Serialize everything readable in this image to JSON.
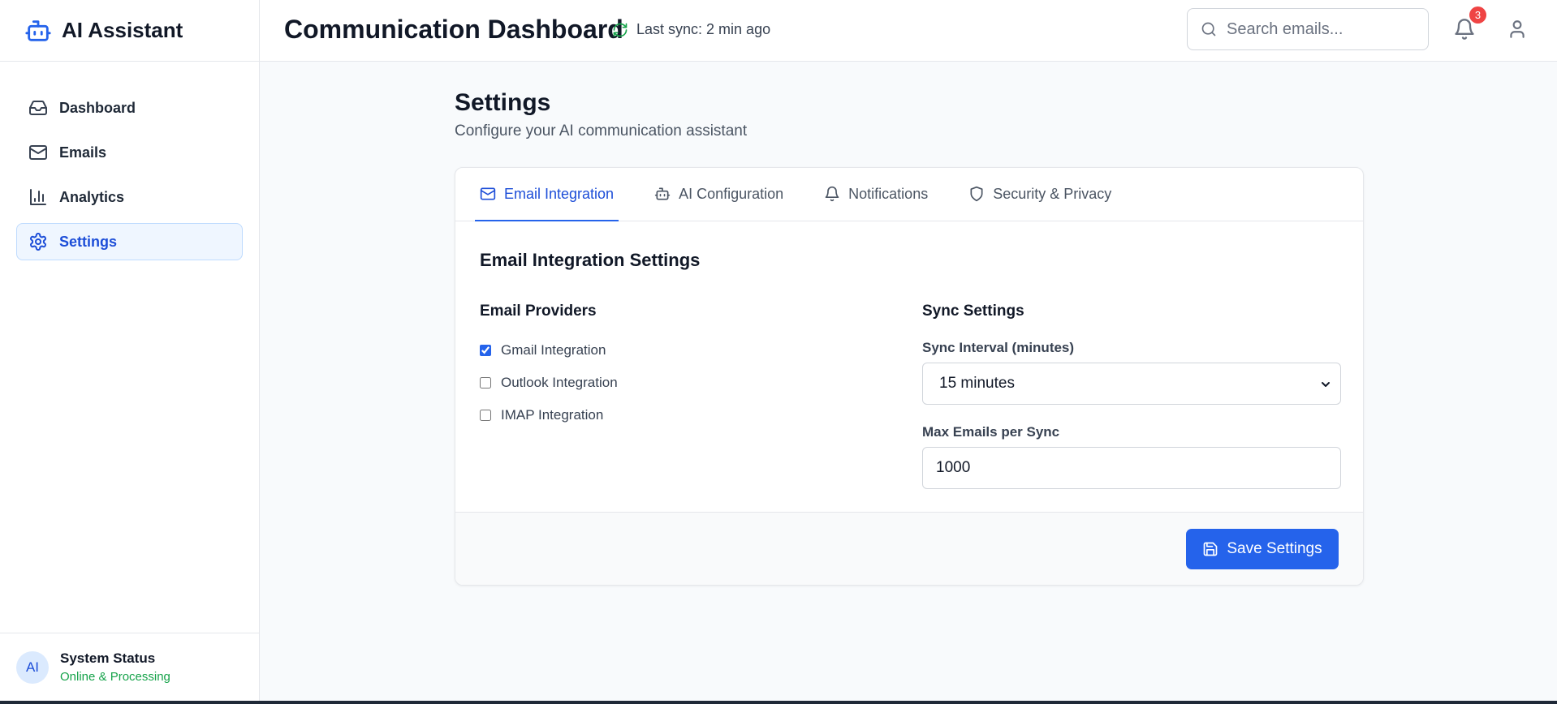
{
  "app": {
    "name": "AI Assistant"
  },
  "sidebar": {
    "items": [
      {
        "label": "Dashboard",
        "icon": "inbox-icon"
      },
      {
        "label": "Emails",
        "icon": "mail-icon"
      },
      {
        "label": "Analytics",
        "icon": "bar-chart-icon"
      },
      {
        "label": "Settings",
        "icon": "gear-icon",
        "active": true
      }
    ],
    "status": {
      "avatar": "AI",
      "title": "System Status",
      "subtitle": "Online & Processing"
    }
  },
  "header": {
    "title": "Communication Dashboard",
    "sync_text": "Last sync: 2 min ago",
    "search_placeholder": "Search emails...",
    "notification_count": "3"
  },
  "main": {
    "title": "Settings",
    "subtitle": "Configure your AI communication assistant",
    "tabs": [
      {
        "label": "Email Integration",
        "icon": "mail-icon",
        "active": true
      },
      {
        "label": "AI Configuration",
        "icon": "bot-icon"
      },
      {
        "label": "Notifications",
        "icon": "bell-icon"
      },
      {
        "label": "Security & Privacy",
        "icon": "shield-icon"
      }
    ],
    "section_title": "Email Integration Settings",
    "providers": {
      "title": "Email Providers",
      "items": [
        {
          "label": "Gmail Integration",
          "checked": true
        },
        {
          "label": "Outlook Integration",
          "checked": false
        },
        {
          "label": "IMAP Integration",
          "checked": false
        }
      ]
    },
    "sync": {
      "title": "Sync Settings",
      "interval_label": "Sync Interval (minutes)",
      "interval_value": "15 minutes",
      "max_label": "Max Emails per Sync",
      "max_value": "1000"
    },
    "save_label": "Save Settings"
  },
  "colors": {
    "accent": "#2563eb",
    "status_green": "#16a34a",
    "badge_red": "#ef4444"
  }
}
